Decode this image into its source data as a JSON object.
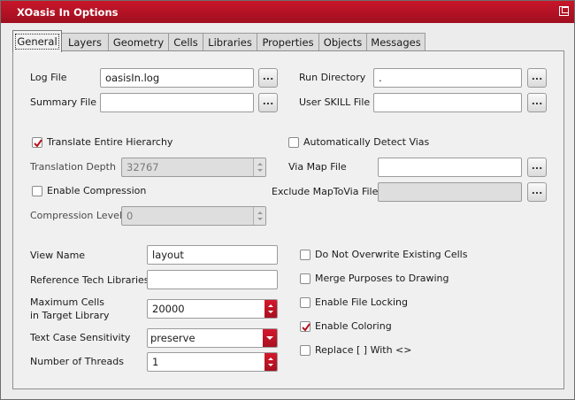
{
  "window": {
    "title": "XOasis In Options"
  },
  "tabs": [
    {
      "label": "General",
      "active": true
    },
    {
      "label": "Layers"
    },
    {
      "label": "Geometry"
    },
    {
      "label": "Cells"
    },
    {
      "label": "Libraries"
    },
    {
      "label": "Properties"
    },
    {
      "label": "Objects"
    },
    {
      "label": "Messages"
    }
  ],
  "general": {
    "log_file": {
      "label": "Log File",
      "value": "oasisIn.log"
    },
    "run_directory": {
      "label": "Run Directory",
      "value": "."
    },
    "summary_file": {
      "label": "Summary File",
      "value": ""
    },
    "user_skill_file": {
      "label": "User SKILL File",
      "value": ""
    },
    "browse_label": "...",
    "translate_entire_hierarchy": {
      "label": "Translate Entire Hierarchy",
      "checked": true
    },
    "auto_detect_vias": {
      "label": "Automatically Detect Vias",
      "checked": false
    },
    "translation_depth": {
      "label": "Translation Depth",
      "value": "32767"
    },
    "via_map_file": {
      "label": "Via Map File",
      "value": ""
    },
    "enable_compression": {
      "label": "Enable Compression",
      "checked": false
    },
    "exclude_maptovia_file": {
      "label": "Exclude MapToVia File",
      "value": ""
    },
    "compression_level": {
      "label": "Compression Level",
      "value": "0"
    },
    "view_name": {
      "label": "View Name",
      "value": "layout"
    },
    "reference_tech_libraries": {
      "label": "Reference Tech Libraries",
      "value": ""
    },
    "maximum_cells": {
      "label_line1": "Maximum Cells",
      "label_line2": "in Target Library",
      "value": "20000"
    },
    "text_case_sensitivity": {
      "label": "Text Case Sensitivity",
      "value": "preserve"
    },
    "number_of_threads": {
      "label": "Number of Threads",
      "value": "1"
    },
    "do_not_overwrite": {
      "label": "Do Not Overwrite Existing Cells",
      "checked": false
    },
    "merge_purposes": {
      "label": "Merge Purposes to Drawing",
      "checked": false
    },
    "enable_file_locking": {
      "label": "Enable File Locking",
      "checked": false
    },
    "enable_coloring": {
      "label": "Enable Coloring",
      "checked": true
    },
    "replace_brackets": {
      "label": "Replace [ ] With <>",
      "checked": false
    }
  },
  "colors": {
    "accent": "#b5121f",
    "title_text": "#ffffff"
  }
}
